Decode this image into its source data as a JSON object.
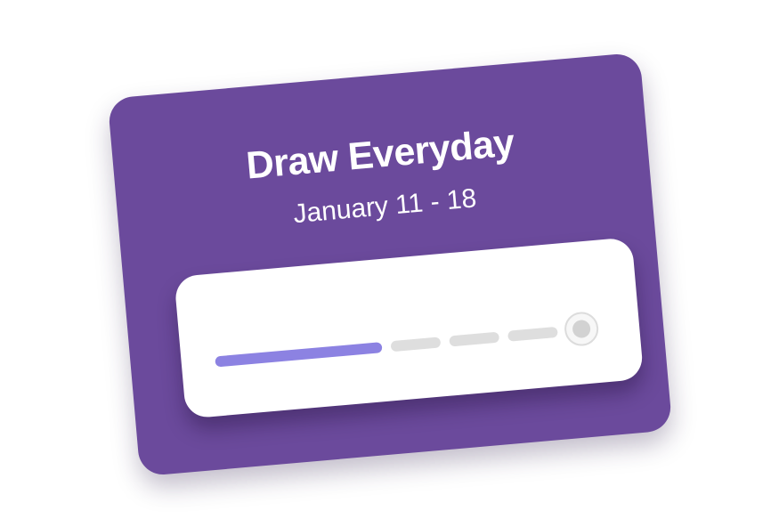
{
  "challenge": {
    "title": "Draw Everyday",
    "date_range": "January 11 - 18"
  },
  "progress": {
    "total_segments": 5,
    "completed_segments": 2,
    "fraction_complete": 0.4,
    "colors": {
      "card": "#6b4a9c",
      "filled": "#8c82e2",
      "empty": "#dedede",
      "panel": "#ffffff"
    },
    "end_marker_icon": "circle-target-icon"
  }
}
